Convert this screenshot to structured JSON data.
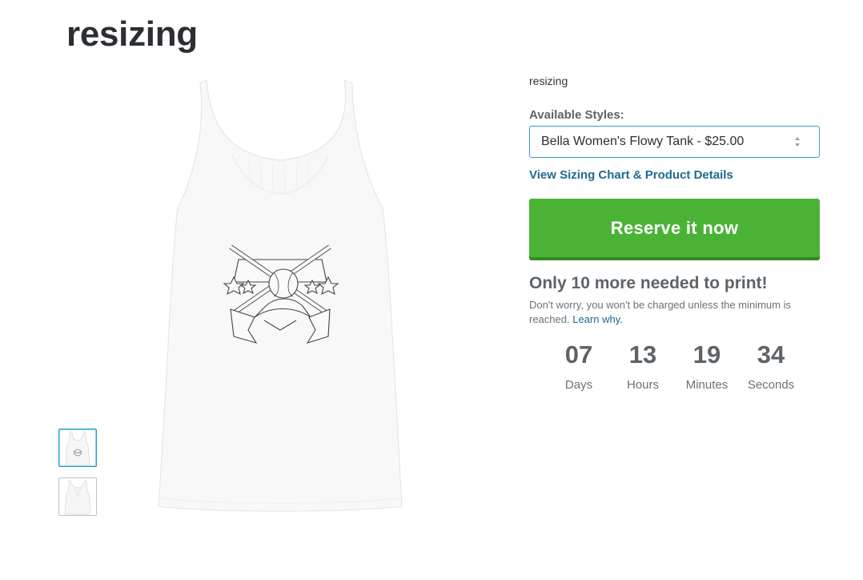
{
  "page": {
    "title": "resizing"
  },
  "gallery": {
    "thumbnails": [
      {
        "name": "front",
        "selected": true
      },
      {
        "name": "back",
        "selected": false
      }
    ]
  },
  "product": {
    "description": "resizing",
    "styles_label": "Available Styles:",
    "selected_style": "Bella Women's Flowy Tank - $25.00",
    "sizing_link": "View Sizing Chart & Product Details",
    "reserve_button": "Reserve it now",
    "needed_text": "Only 10 more needed to print!",
    "note_text": "Don't worry, you won't be charged unless the minimum is reached.",
    "learn_why": "Learn why."
  },
  "countdown": {
    "days": {
      "value": "07",
      "label": "Days"
    },
    "hours": {
      "value": "13",
      "label": "Hours"
    },
    "minutes": {
      "value": "19",
      "label": "Minutes"
    },
    "seconds": {
      "value": "34",
      "label": "Seconds"
    }
  },
  "colors": {
    "button_green": "#4ab335",
    "link_blue": "#1d6a8f",
    "select_border": "#3a9ec3",
    "heading_gray": "#5d6368"
  }
}
